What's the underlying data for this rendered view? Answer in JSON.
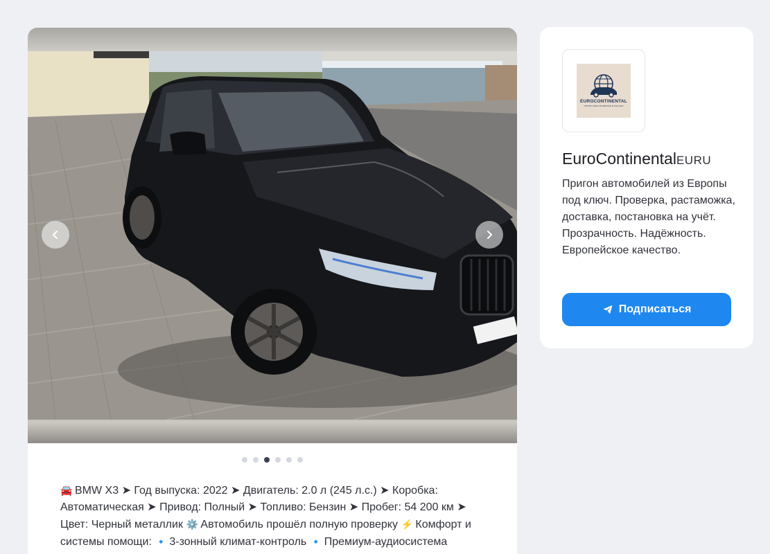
{
  "gallery": {
    "photo_alt": "",
    "slide_count": 6,
    "active_slide": 3
  },
  "post": {
    "segments": [
      {
        "emoji": "🚘",
        "text": "BMW X3 ➤ Год выпуска: 2022 ➤ Двигатель: 2.0 л (245 л.с.) ➤ Коробка: Автоматическая ➤ Привод: Полный ➤ Топливо: Бензин ➤ Пробег: 54 200 км ➤ Цвет: Черный металлик "
      },
      {
        "emoji": "⚙️",
        "text": "Автомобиль прошёл полную проверку "
      },
      {
        "emoji": "⚡",
        "text": "Комфорт и системы помощи: "
      },
      {
        "emoji": "🔹",
        "text": "3-зонный климат-контроль "
      },
      {
        "emoji": "🔹",
        "text": "Премиум-аудиосистема"
      }
    ]
  },
  "channel": {
    "logo_text": "EUROCONTINENTAL",
    "logo_subtext": "ПРИГОН АВТО ИЗ ЕВРОПЫ В РОССИЮ",
    "name": "EuroContinental",
    "tag": "EURU",
    "description": "Пригон автомобилей из Европы под ключ. Проверка, растаможка, доставка, постановка на учёт. Прозрачность. Надёжность. Европейское качество.",
    "subscribe_label": "Подписаться"
  },
  "colors": {
    "page_bg": "#eef0f4",
    "accent": "#1e87f0",
    "dot_active": "#3a4150",
    "dot_inactive": "#d5d8df"
  }
}
